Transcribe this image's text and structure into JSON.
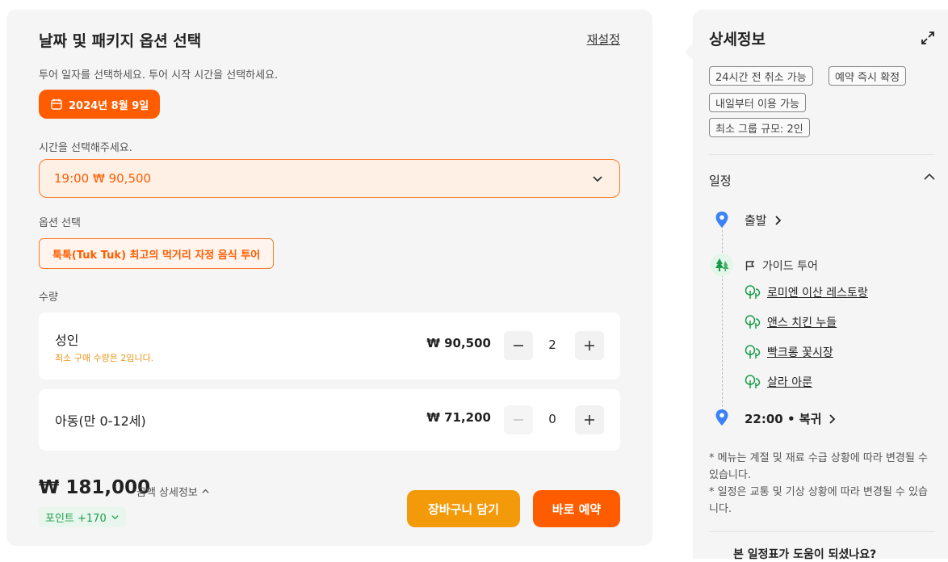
{
  "left": {
    "title": "날짜 및 패키지 옵션 선택",
    "reset": "재설정",
    "hint": "투어 일자를 선택하세요. 투어 시작 시간을 선택하세요.",
    "date": "2024년 8월 9일",
    "time_label": "시간을 선택해주세요.",
    "time_value": "19:00 ₩ 90,500",
    "option_label": "옵션 선택",
    "option_value": "툭툭(Tuk Tuk) 최고의 먹거리 자정 음식 투어",
    "quantity_label": "수량",
    "adult": {
      "name": "성인",
      "note": "최소 구매 수량은 2입니다.",
      "price": "₩ 90,500",
      "qty": "2"
    },
    "child": {
      "name": "아동(만 0-12세)",
      "price": "₩ 71,200",
      "qty": "0"
    },
    "total": "₩ 181,000",
    "price_detail": "금액 상세정보",
    "points": "포인트 +170",
    "cart_button": "장바구니 담기",
    "book_button": "바로 예약"
  },
  "right": {
    "title": "상세정보",
    "tags": [
      "24시간 전 취소 가능",
      "예약 즉시 확정",
      "내일부터 이용 가능",
      "최소 그룹 규모: 2인"
    ],
    "schedule_label": "일정",
    "departure": "출발",
    "guide": "가이드 투어",
    "stops": [
      "로미엔 이산 레스토랑",
      "앤스 치킨 누들",
      "빡크롱 꽃시장",
      "살라 아룬"
    ],
    "return": "22:00 • 복귀",
    "notes": [
      "* 메뉴는 계절 및 재료 수급 상황에 따라 변경될 수 있습니다.",
      "* 일정은 교통 및 기상 상황에 따라 변경될 수 있습니다."
    ],
    "bottom_question": "본 일정표가 도움이 되셨나요?"
  },
  "colors": {
    "accent": "#ff5c00",
    "cart": "#f29a0a",
    "green": "#1a9d4b",
    "pin": "#3b82f6"
  }
}
